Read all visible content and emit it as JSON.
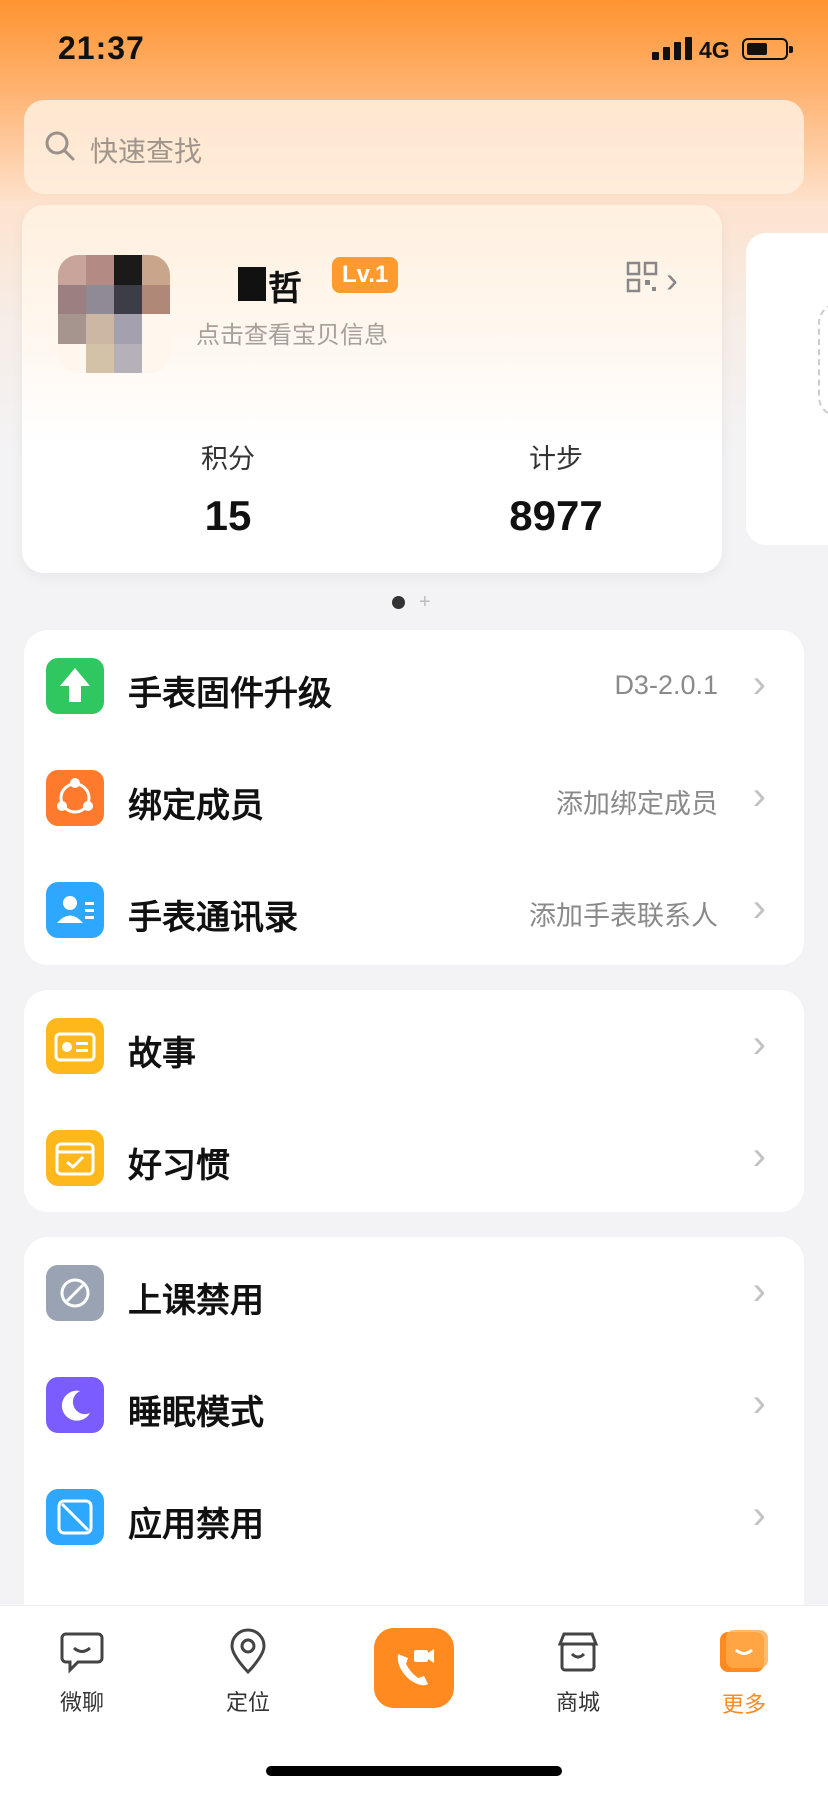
{
  "status": {
    "time": "21:37",
    "network": "4G"
  },
  "search": {
    "placeholder": "快速查找"
  },
  "profile": {
    "name_suffix": "哲",
    "level": "Lv.1",
    "hint": "点击查看宝贝信息",
    "stats": [
      {
        "label": "积分",
        "value": "15"
      },
      {
        "label": "计步",
        "value": "8977"
      }
    ]
  },
  "groups": [
    {
      "items": [
        {
          "label": "手表固件升级",
          "value": "D3-2.0.1",
          "icon": "upgrade-arrow-icon",
          "color": "#2fc760"
        },
        {
          "label": "绑定成员",
          "value": "添加绑定成员",
          "icon": "members-share-icon",
          "color": "#ff7a2d"
        },
        {
          "label": "手表通讯录",
          "value": "添加手表联系人",
          "icon": "contacts-icon",
          "color": "#2ea7ff"
        }
      ]
    },
    {
      "items": [
        {
          "label": "故事",
          "value": "",
          "icon": "radio-icon",
          "color": "#ffb81c"
        },
        {
          "label": "好习惯",
          "value": "",
          "icon": "calendar-check-icon",
          "color": "#ffb81c"
        }
      ]
    },
    {
      "items": [
        {
          "label": "上课禁用",
          "value": "",
          "icon": "watch-ban-icon",
          "color": "#9aa3b3"
        },
        {
          "label": "睡眠模式",
          "value": "",
          "icon": "moon-icon",
          "color": "#7a5cff"
        },
        {
          "label": "应用禁用",
          "value": "",
          "icon": "app-ban-icon",
          "color": "#2ea7ff"
        }
      ]
    }
  ],
  "tabs": [
    {
      "label": "微聊",
      "icon": "chat-icon"
    },
    {
      "label": "定位",
      "icon": "location-pin-icon"
    },
    {
      "label": "",
      "icon": "video-call-icon"
    },
    {
      "label": "商城",
      "icon": "store-icon"
    },
    {
      "label": "更多",
      "icon": "more-icon",
      "active": true
    }
  ],
  "colors": {
    "accent": "#ff8a1f",
    "background": "#f3f3f5"
  }
}
